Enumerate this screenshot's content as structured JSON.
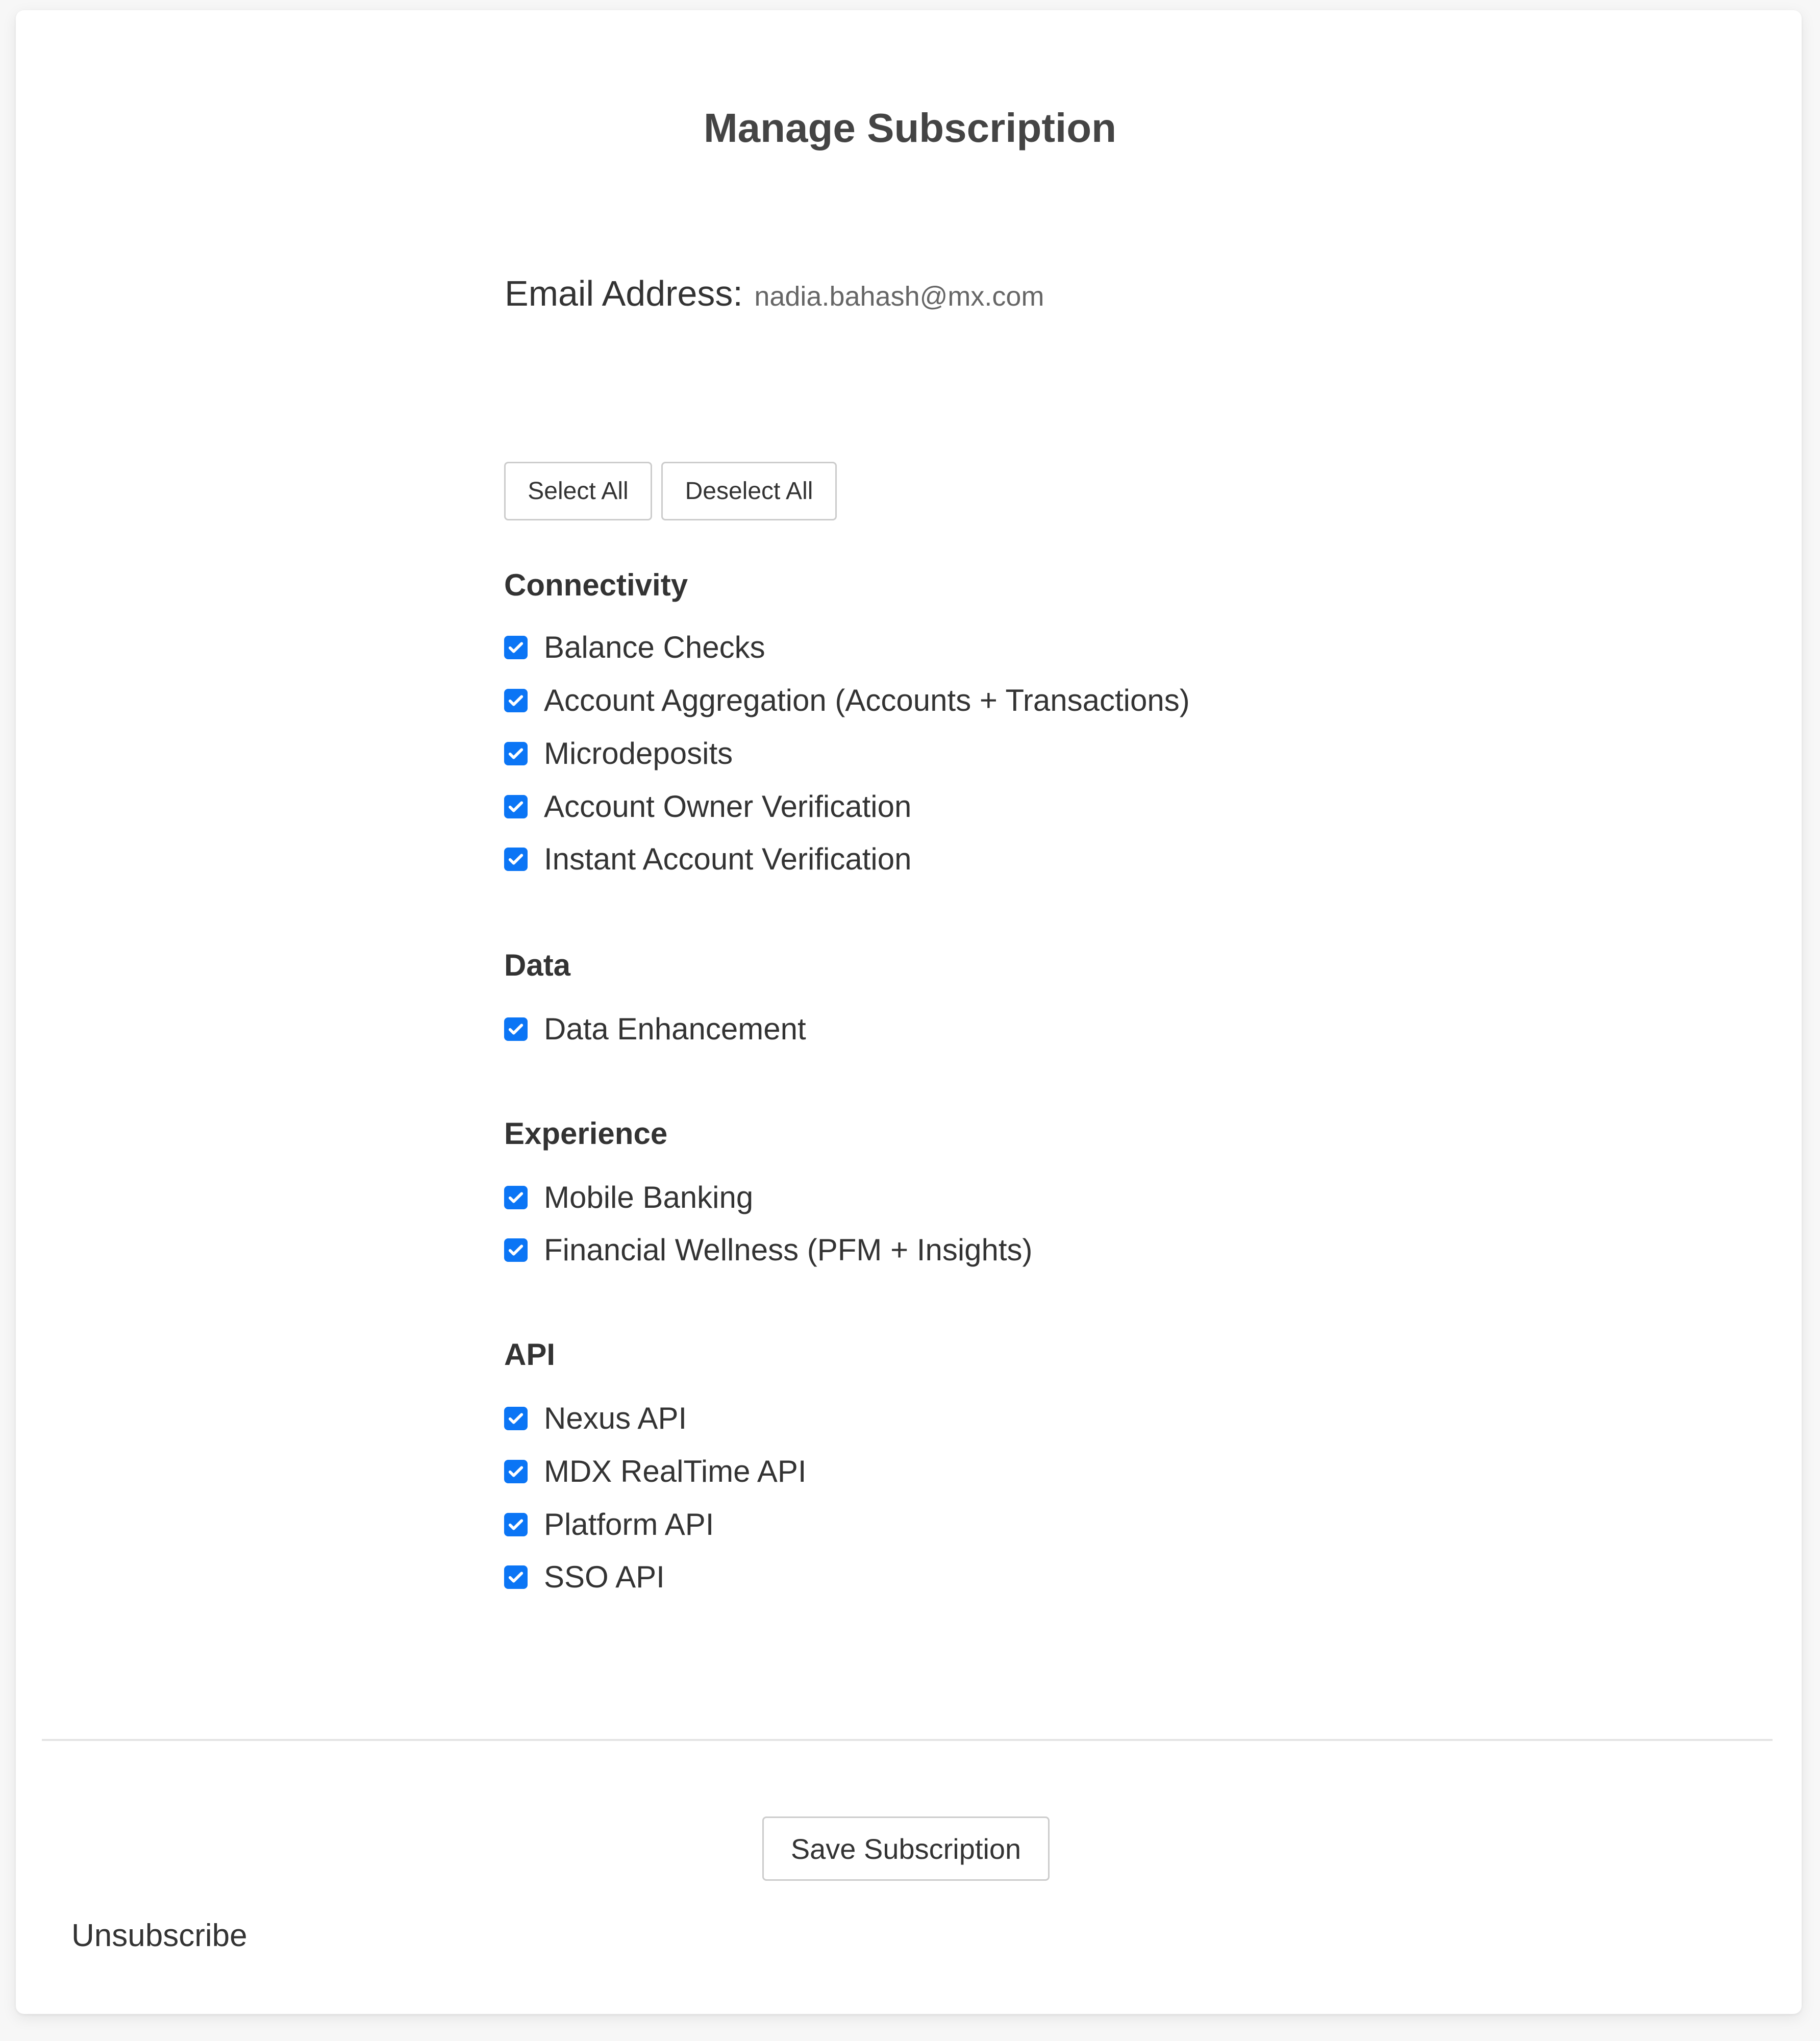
{
  "page": {
    "title": "Manage Subscription",
    "email_label": "Email Address:",
    "email_value": "nadia.bahash@mx.com"
  },
  "actions": {
    "select_all": "Select All",
    "deselect_all": "Deselect All",
    "save": "Save Subscription",
    "unsubscribe": "Unsubscribe"
  },
  "colors": {
    "checkbox_checked": "#0b75f5"
  },
  "sections": [
    {
      "heading": "Connectivity",
      "items": [
        {
          "label": "Balance Checks",
          "checked": true
        },
        {
          "label": "Account Aggregation (Accounts + Transactions)",
          "checked": true
        },
        {
          "label": "Microdeposits",
          "checked": true
        },
        {
          "label": "Account Owner Verification",
          "checked": true
        },
        {
          "label": "Instant Account Verification",
          "checked": true
        }
      ]
    },
    {
      "heading": "Data",
      "items": [
        {
          "label": "Data Enhancement",
          "checked": true
        }
      ]
    },
    {
      "heading": "Experience",
      "items": [
        {
          "label": "Mobile Banking",
          "checked": true
        },
        {
          "label": "Financial Wellness (PFM + Insights)",
          "checked": true
        }
      ]
    },
    {
      "heading": "API",
      "items": [
        {
          "label": "Nexus API",
          "checked": true
        },
        {
          "label": "MDX RealTime API",
          "checked": true
        },
        {
          "label": "Platform API",
          "checked": true
        },
        {
          "label": "SSO API",
          "checked": true
        }
      ]
    }
  ]
}
